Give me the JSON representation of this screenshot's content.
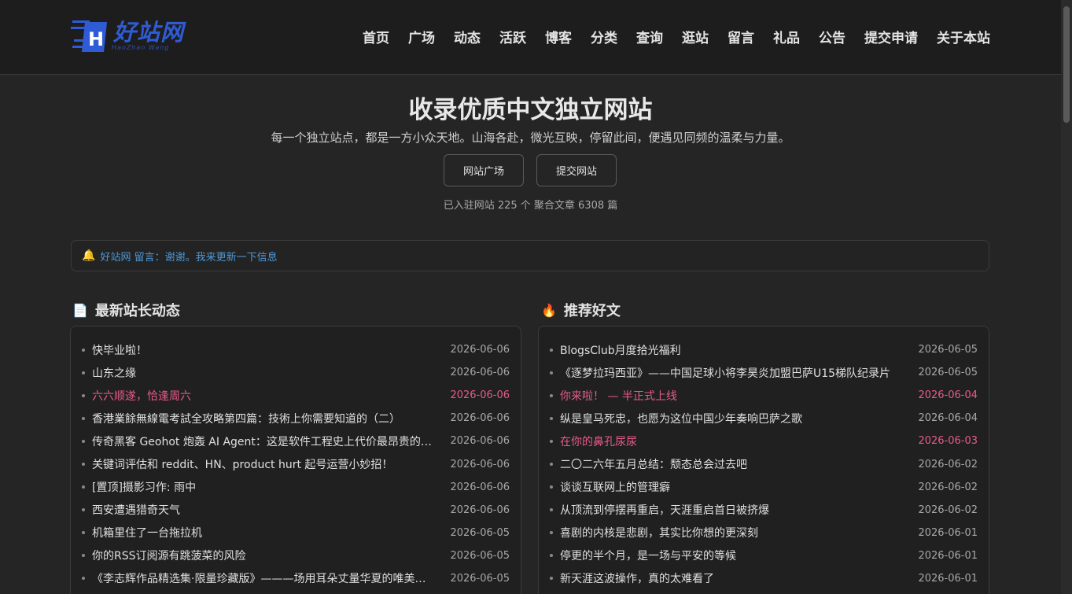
{
  "logo": {
    "text": "好站网",
    "sub": "HaoZhan Wang",
    "letter": "H"
  },
  "nav": [
    "首页",
    "广场",
    "动态",
    "活跃",
    "博客",
    "分类",
    "查询",
    "逛站",
    "留言",
    "礼品",
    "公告",
    "提交申请",
    "关于本站"
  ],
  "hero": {
    "title": "收录优质中文独立网站",
    "subtitle": "每一个独立站点，都是一方小众天地。山海各赴，微光互映，停留此间，便遇见同频的温柔与力量。",
    "btn_plaza": "网站广场",
    "btn_submit": "提交网站",
    "stats": "已入驻网站 225 个 聚合文章 6308 篇"
  },
  "notice": "好站网 留言：谢谢。我来更新一下信息",
  "latest": {
    "title": "最新站长动态",
    "items": [
      {
        "title": "快毕业啦！",
        "date": "2026-06-06",
        "hl": false
      },
      {
        "title": "山东之缘",
        "date": "2026-06-06",
        "hl": false
      },
      {
        "title": "六六顺遂，恰逢周六",
        "date": "2026-06-06",
        "hl": true
      },
      {
        "title": "香港業餘無線電考試全攻略第四篇：技術上你需要知道的（二）",
        "date": "2026-06-06",
        "hl": false
      },
      {
        "title": "传奇黑客 Geohot 炮轰 AI Agent：这是软件工程史上代价最昂贵的灾难",
        "date": "2026-06-06",
        "hl": false
      },
      {
        "title": "关键词评估和 reddit、HN、product hurt 起号运营小妙招！",
        "date": "2026-06-06",
        "hl": false
      },
      {
        "title": "[置顶]摄影习作: 雨中",
        "date": "2026-06-06",
        "hl": false
      },
      {
        "title": "西安遭遇猎奇天气",
        "date": "2026-06-06",
        "hl": false
      },
      {
        "title": "机箱里住了一台拖拉机",
        "date": "2026-06-05",
        "hl": false
      },
      {
        "title": "你的RSS订阅源有跳菠菜的风险",
        "date": "2026-06-05",
        "hl": false
      },
      {
        "title": "《李志辉作品精选集·限量珍藏版》———场用耳朵丈量华夏的唯美旅程",
        "date": "2026-06-05",
        "hl": false
      }
    ]
  },
  "recommend": {
    "title": "推荐好文",
    "items": [
      {
        "title": "BlogsClub月度拾光福利",
        "date": "2026-06-05",
        "hl": false
      },
      {
        "title": "《逐梦拉玛西亚》——中国足球小将李昊炎加盟巴萨U15梯队纪录片",
        "date": "2026-06-05",
        "hl": false
      },
      {
        "title": "你来啦！ — 半正式上线",
        "date": "2026-06-04",
        "hl": true
      },
      {
        "title": "纵是皇马死忠，也愿为这位中国少年奏响巴萨之歌",
        "date": "2026-06-04",
        "hl": false
      },
      {
        "title": "在你的鼻孔尿尿",
        "date": "2026-06-03",
        "hl": true
      },
      {
        "title": "二〇二六年五月总结：颓态总会过去吧",
        "date": "2026-06-02",
        "hl": false
      },
      {
        "title": "谈谈互联网上的管理癖",
        "date": "2026-06-02",
        "hl": false
      },
      {
        "title": "从顶流到停摆再重启，天涯重启首日被挤爆",
        "date": "2026-06-02",
        "hl": false
      },
      {
        "title": "喜剧的内核是悲剧，其实比你想的更深刻",
        "date": "2026-06-01",
        "hl": false
      },
      {
        "title": "停更的半个月，是一场与平安的等候",
        "date": "2026-06-01",
        "hl": false
      },
      {
        "title": "新天涯这波操作，真的太难看了",
        "date": "2026-06-01",
        "hl": false
      }
    ]
  },
  "colors": {
    "accent_pink": "#e85a8c",
    "link_blue": "#4f97d6",
    "logo_blue": "#2f5bd6"
  }
}
